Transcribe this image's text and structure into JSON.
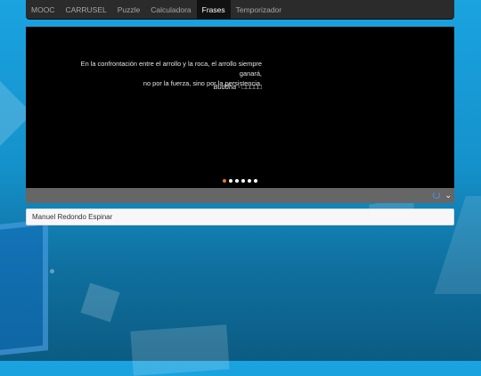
{
  "nav": {
    "items": [
      {
        "label": "MOOC",
        "active": false
      },
      {
        "label": "CARRUSEL",
        "active": false
      },
      {
        "label": "Puzzle",
        "active": false
      },
      {
        "label": "Calculadora",
        "active": false
      },
      {
        "label": "Frases",
        "active": true
      },
      {
        "label": "Temporizador",
        "active": false
      }
    ]
  },
  "carousel": {
    "quote_line1": "En la confrontación entre el arrollo y la roca, el arrollo siempre ganará,",
    "quote_line2": "no por la fuerza, sino por la persistencia.",
    "author": "Buddha - □□□□□",
    "indicator_count": 6,
    "active_indicator": 0,
    "active_indicator_color": "#e8762c"
  },
  "controls": {
    "icons": [
      "spinner-icon",
      "chevron-down-icon"
    ]
  },
  "footer": {
    "author_name": "Manuel Redondo Espinar"
  }
}
